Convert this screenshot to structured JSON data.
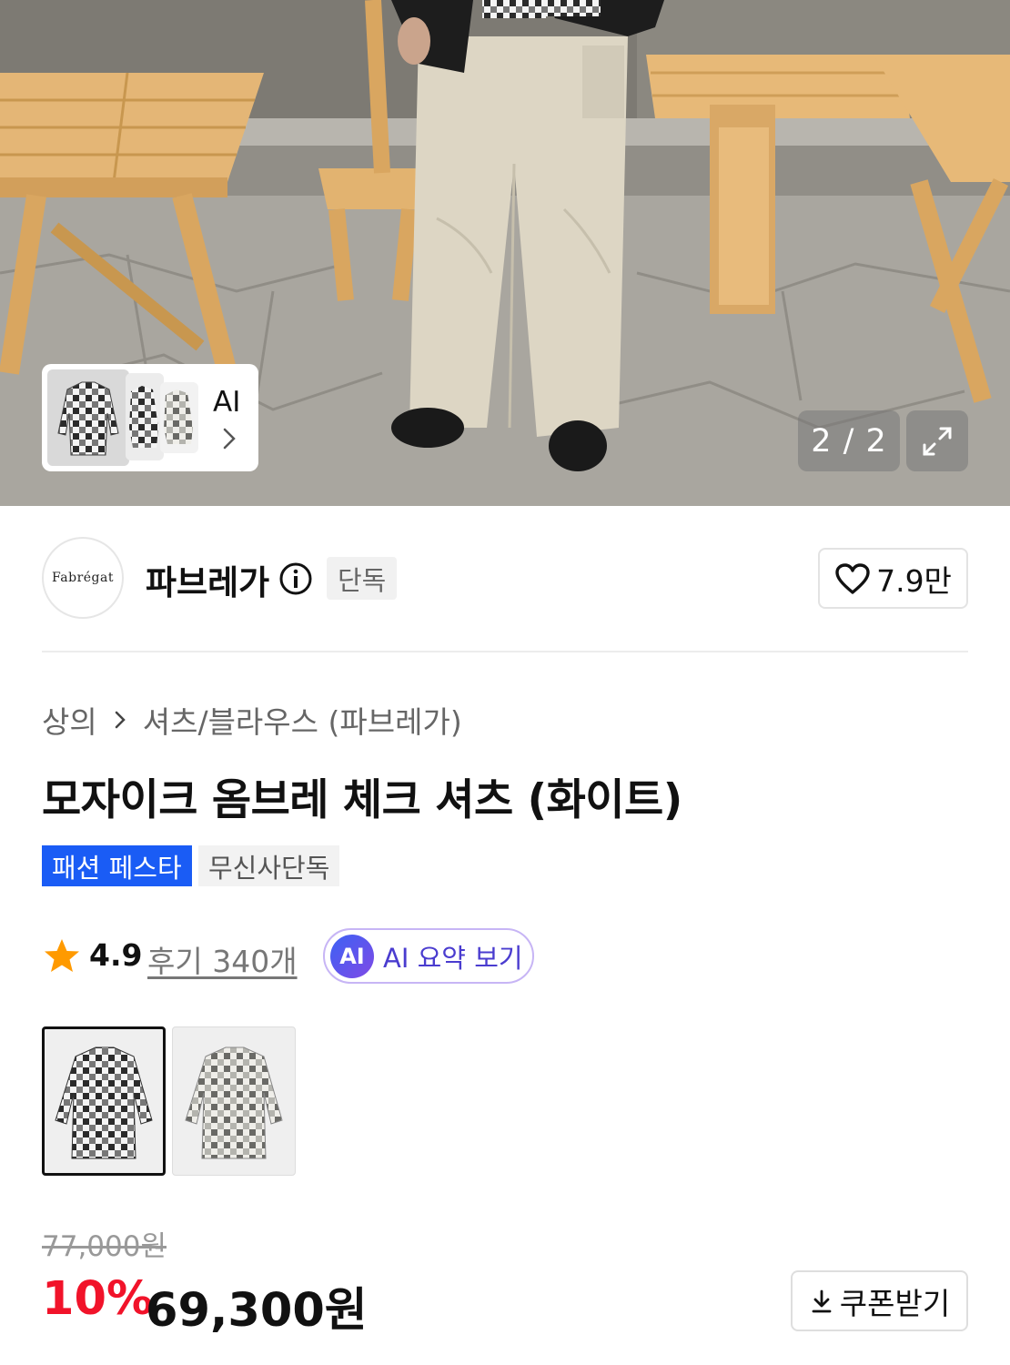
{
  "gallery": {
    "ai_card_label": "AI",
    "page_counter": "2 / 2"
  },
  "brand": {
    "logo_text": "Fabrégat",
    "name": "파브레가",
    "tag": "단독",
    "like_count": "7.9만"
  },
  "product": {
    "breadcrumb": [
      "상의",
      "셔츠/블라우스 (파브레가)"
    ],
    "title": "모자이크 옴브레 체크 셔츠 (화이트)",
    "badges": [
      "패션 페스타",
      "무신사단독"
    ],
    "rating": "4.9",
    "reviews_label": "후기 340개",
    "ai_summary_badge": "AI",
    "ai_summary_label": "AI 요약 보기",
    "color_options_selected_index": 0,
    "color_option_count": 2
  },
  "price": {
    "original": "77,000원",
    "discount": "10%",
    "final": "69,300원",
    "coupon_label": "쿠폰받기"
  },
  "colors": {
    "discount_red": "#f1132a",
    "festa_blue": "#1a5cf5",
    "ai_purple": "#4a3ccf"
  },
  "icons": [
    "info-icon",
    "heart-icon",
    "star-icon",
    "chevron-right-icon",
    "expand-icon",
    "download-icon",
    "ai-icon"
  ]
}
